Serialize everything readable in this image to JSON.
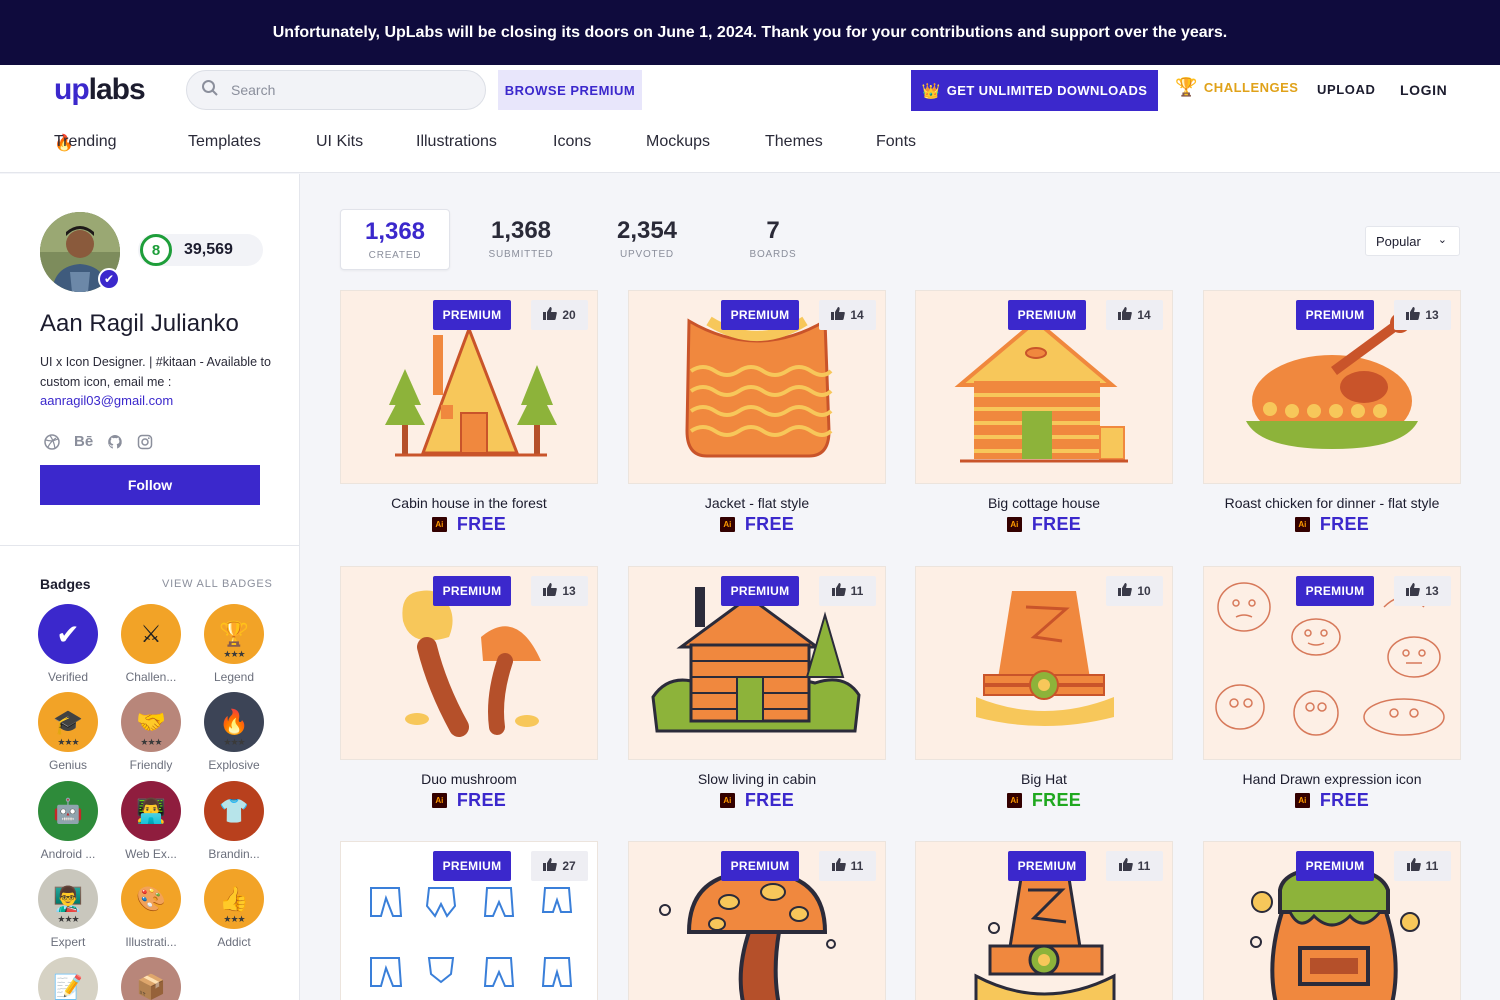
{
  "banner": {
    "text": "Unfortunately, UpLabs will be closing its doors on June 1, 2024. Thank you for your contributions and support over the years."
  },
  "header": {
    "logo_up": "up",
    "logo_labs": "labs",
    "search_placeholder": "Search",
    "browse_premium": "BROWSE PREMIUM",
    "get_unlimited": "GET UNLIMITED DOWNLOADS",
    "challenges": "CHALLENGES",
    "upload": "UPLOAD",
    "login": "LOGIN"
  },
  "categories": [
    "Trending",
    "Templates",
    "UI Kits",
    "Illustrations",
    "Icons",
    "Mockups",
    "Themes",
    "Fonts"
  ],
  "profile": {
    "level": "8",
    "points": "39,569",
    "name": "Aan Ragil Julianko",
    "bio": "UI x Icon Designer. | #kitaan - Available to custom icon, email me :",
    "email": "aanragil03@gmail.com",
    "follow_label": "Follow",
    "social_icons": [
      "dribbble-icon",
      "behance-icon",
      "github-icon",
      "instagram-icon"
    ],
    "behance_text": "Bē"
  },
  "badges": {
    "title": "Badges",
    "view_all": "VIEW ALL BADGES",
    "items": [
      {
        "label": "Verified",
        "icon": "check-icon",
        "glyph": "✔",
        "color": "#3b28cc",
        "stars": ""
      },
      {
        "label": "Challen...",
        "icon": "swords-icon",
        "glyph": "⚔",
        "color": "#f2a327",
        "stars": ""
      },
      {
        "label": "Legend",
        "icon": "trophy-icon",
        "glyph": "🏆",
        "color": "#f2a327",
        "stars": "★★★"
      },
      {
        "label": "Genius",
        "icon": "graduation-cap-icon",
        "glyph": "🎓",
        "color": "#f2a327",
        "stars": "★★★"
      },
      {
        "label": "Friendly",
        "icon": "handshake-icon",
        "glyph": "🤝",
        "color": "#b8867a",
        "stars": "★★★"
      },
      {
        "label": "Explosive",
        "icon": "fire-icon",
        "glyph": "🔥",
        "color": "#3c4456",
        "stars": "★★★"
      },
      {
        "label": "Android ...",
        "icon": "robot-icon",
        "glyph": "🤖",
        "color": "#2e8b3a",
        "stars": ""
      },
      {
        "label": "Web Ex...",
        "icon": "laptop-user-icon",
        "glyph": "👨‍💻",
        "color": "#8f1d3e",
        "stars": ""
      },
      {
        "label": "Brandin...",
        "icon": "shirt-icon",
        "glyph": "👕",
        "color": "#b8401d",
        "stars": ""
      },
      {
        "label": "Expert",
        "icon": "expert-icon",
        "glyph": "👨‍🏫",
        "color": "#c9c7bd",
        "stars": "★★★"
      },
      {
        "label": "Illustrati...",
        "icon": "palette-icon",
        "glyph": "🎨",
        "color": "#f2a327",
        "stars": ""
      },
      {
        "label": "Addict",
        "icon": "thumbs-up-icon",
        "glyph": "👍",
        "color": "#f2a327",
        "stars": "★★★"
      },
      {
        "label": "",
        "icon": "notepad-icon",
        "glyph": "📝",
        "color": "#d6d2c4",
        "stars": ""
      },
      {
        "label": "",
        "icon": "box-icon",
        "glyph": "📦",
        "color": "#b8867a",
        "stars": ""
      }
    ]
  },
  "stats": [
    {
      "value": "1,368",
      "label": "CREATED"
    },
    {
      "value": "1,368",
      "label": "SUBMITTED"
    },
    {
      "value": "2,354",
      "label": "UPVOTED"
    },
    {
      "value": "7",
      "label": "BOARDS"
    }
  ],
  "sort": {
    "selected": "Popular"
  },
  "premium_tag": "PREMIUM",
  "free_label": "FREE",
  "ai_label": "Ai",
  "cards": [
    {
      "title": "Cabin house in the forest",
      "likes": "20",
      "premium": true,
      "free_color": "#3b28cc",
      "art": "cabin-forest"
    },
    {
      "title": "Jacket - flat style",
      "likes": "14",
      "premium": true,
      "free_color": "#3b28cc",
      "art": "jacket"
    },
    {
      "title": "Big cottage house",
      "likes": "14",
      "premium": true,
      "free_color": "#3b28cc",
      "art": "cottage"
    },
    {
      "title": "Roast chicken for dinner - flat style",
      "likes": "13",
      "premium": true,
      "free_color": "#3b28cc",
      "art": "chicken"
    },
    {
      "title": "Duo mushroom",
      "likes": "13",
      "premium": true,
      "free_color": "#3b28cc",
      "art": "mushroom-duo"
    },
    {
      "title": "Slow living in cabin",
      "likes": "11",
      "premium": true,
      "free_color": "#3b28cc",
      "art": "log-cabin"
    },
    {
      "title": "Big Hat",
      "likes": "10",
      "premium": false,
      "free_color": "#1fa81f",
      "art": "hat"
    },
    {
      "title": "Hand Drawn expression icon",
      "likes": "13",
      "premium": true,
      "free_color": "#3b28cc",
      "art": "expressions"
    },
    {
      "title": "",
      "likes": "27",
      "premium": true,
      "free_color": "#3b28cc",
      "art": "pants"
    },
    {
      "title": "",
      "likes": "11",
      "premium": true,
      "free_color": "#3b28cc",
      "art": "mushroom-big"
    },
    {
      "title": "",
      "likes": "11",
      "premium": true,
      "free_color": "#3b28cc",
      "art": "hat-outline"
    },
    {
      "title": "",
      "likes": "11",
      "premium": true,
      "free_color": "#3b28cc",
      "art": "honey-pot"
    }
  ]
}
